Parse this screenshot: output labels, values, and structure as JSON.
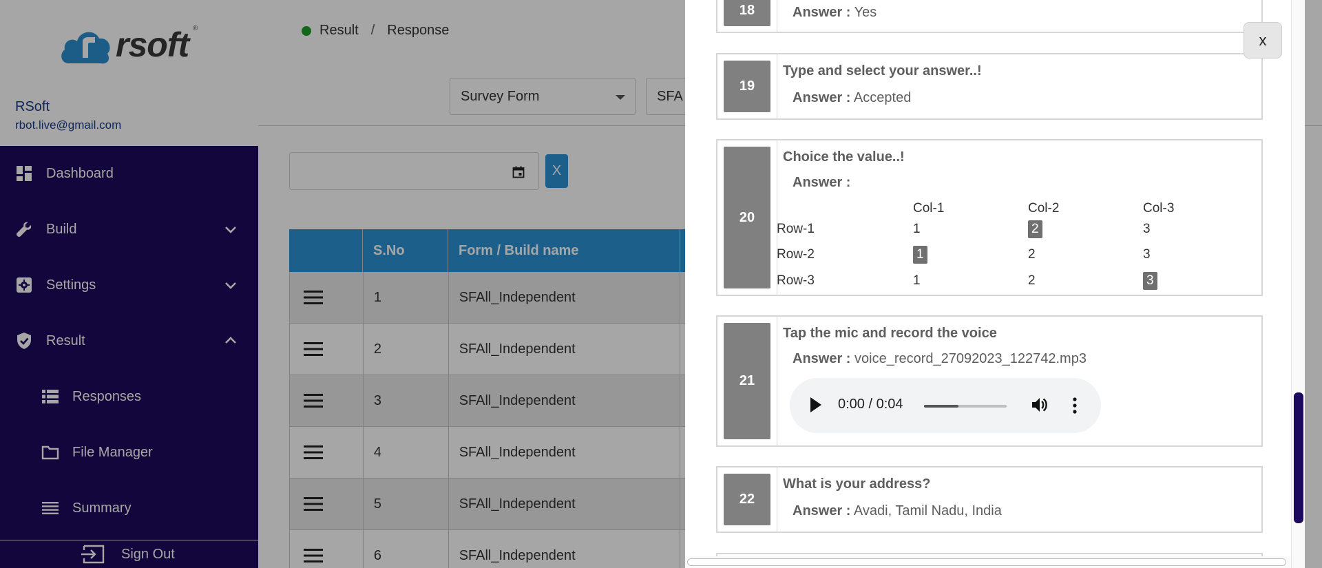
{
  "sidebar": {
    "logo_text": "rsoft",
    "logo_reg": "®",
    "user_name": "RSoft",
    "user_email": "rbot.live@gmail.com",
    "items": [
      {
        "label": "Dashboard",
        "icon": "dashboard-icon"
      },
      {
        "label": "Build",
        "icon": "wrench-icon",
        "chevron": "down"
      },
      {
        "label": "Settings",
        "icon": "gear-icon",
        "chevron": "down"
      },
      {
        "label": "Result",
        "icon": "shield-check-icon",
        "chevron": "up"
      },
      {
        "label": "Responses",
        "icon": "list-icon"
      },
      {
        "label": "File Manager",
        "icon": "folder-icon"
      },
      {
        "label": "Summary",
        "icon": "lines-icon"
      }
    ],
    "sign_out": "Sign Out"
  },
  "breadcrumb": {
    "item1": "Result",
    "separator": "/",
    "item2": "Response"
  },
  "filters": {
    "form_type": "Survey Form",
    "form_name": "SFA"
  },
  "clear_button": "X",
  "table": {
    "headers": [
      "",
      "S.No",
      "Form / Build name",
      ""
    ],
    "rows": [
      {
        "sno": "1",
        "name": "SFAll_Independent"
      },
      {
        "sno": "2",
        "name": "SFAll_Independent"
      },
      {
        "sno": "3",
        "name": "SFAll_Independent"
      },
      {
        "sno": "4",
        "name": "SFAll_Independent"
      },
      {
        "sno": "5",
        "name": "SFAll_Independent"
      },
      {
        "sno": "6",
        "name": "SFAll_Independent"
      }
    ]
  },
  "modal": {
    "close_label": "x",
    "answer_label": "Answer :",
    "questions": [
      {
        "num": "18",
        "answer": "Yes"
      },
      {
        "num": "19",
        "title": "Type and select your answer..!",
        "answer": "Accepted"
      },
      {
        "num": "20",
        "title": "Choice the value..!",
        "grid": {
          "columns": [
            "Col-1",
            "Col-2",
            "Col-3"
          ],
          "rows": [
            {
              "label": "Row-1",
              "values": [
                "1",
                "2",
                "3"
              ],
              "selected": 1
            },
            {
              "label": "Row-2",
              "values": [
                "1",
                "2",
                "3"
              ],
              "selected": 0
            },
            {
              "label": "Row-3",
              "values": [
                "1",
                "2",
                "3"
              ],
              "selected": 2
            }
          ]
        }
      },
      {
        "num": "21",
        "title": "Tap the mic and record the voice",
        "answer": "voice_record_27092023_122742.mp3",
        "audio": {
          "time": "0:00 / 0:04",
          "progress": 0.42
        }
      },
      {
        "num": "22",
        "title": "What is your address?",
        "answer": "Avadi, Tamil Nadu, India"
      }
    ]
  }
}
